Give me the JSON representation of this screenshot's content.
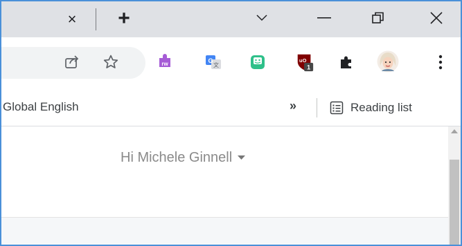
{
  "tabs": {
    "close_icon": "×",
    "new_tab_icon": "+"
  },
  "window": {
    "controls": [
      "tab-search",
      "minimize",
      "restore",
      "close"
    ]
  },
  "toolbar": {
    "icons": [
      "share-icon",
      "bookmark-star-icon",
      "rw-extension-icon",
      "google-translate-icon",
      "emoji-extension-icon",
      "ublock-icon",
      "extensions-puzzle-icon",
      "profile-avatar",
      "menu-kebab-icon"
    ],
    "ublock_badge": "1",
    "rw_label": "rw"
  },
  "bookmarks": {
    "partial_item": "Global English",
    "overflow_glyph": "»",
    "reading_list_label": "Reading list"
  },
  "page": {
    "greeting": "Hi Michele Ginnell"
  },
  "colors": {
    "accent_border": "#4a90d9",
    "tabstrip_bg": "#dfe1e5",
    "greeting_text": "#8a8a8a"
  }
}
